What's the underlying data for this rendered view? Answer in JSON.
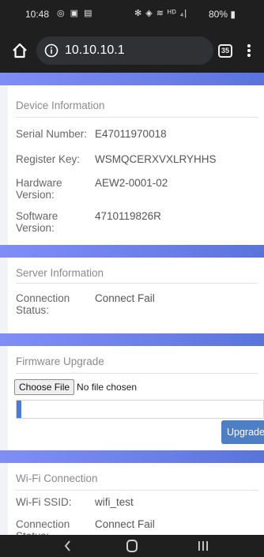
{
  "status_bar": {
    "time": "10:48",
    "left_icons": "◎ ▣ ▤",
    "right_icons": "✻ ◈ ≋ ᴴᴰ ₄|",
    "battery": "80% ▮"
  },
  "browser": {
    "url": "10.10.10.1",
    "tab_count": "35"
  },
  "device_info": {
    "title": "Device Information",
    "rows": [
      {
        "label": "Serial Number:",
        "value": "E47011970018"
      },
      {
        "label": "Register Key:",
        "value": "WSMQCERXVXLRYHHS"
      },
      {
        "label": "Hardware Version:",
        "value": "AEW2-0001-02"
      },
      {
        "label": "Software Version:",
        "value": "4710119826R"
      }
    ]
  },
  "server_info": {
    "title": "Server Information",
    "rows": [
      {
        "label": "Connection Status:",
        "value": "Connect Fail"
      }
    ]
  },
  "firmware": {
    "title": "Firmware Upgrade",
    "choose_file_label": "Choose File",
    "file_status": "No file chosen",
    "upgrade_label": "Upgrade",
    "progress_fraction": 0.02
  },
  "wifi": {
    "title": "Wi-Fi Connection",
    "rows": [
      {
        "label": "Wi-Fi SSID:",
        "value": "wifi_test"
      },
      {
        "label": "Connection Status:",
        "value": "Connect Fail"
      }
    ]
  },
  "colors": {
    "accent_band": "#6b7fe8",
    "button": "#4d7ec6",
    "progress": "#4a7bd8"
  }
}
